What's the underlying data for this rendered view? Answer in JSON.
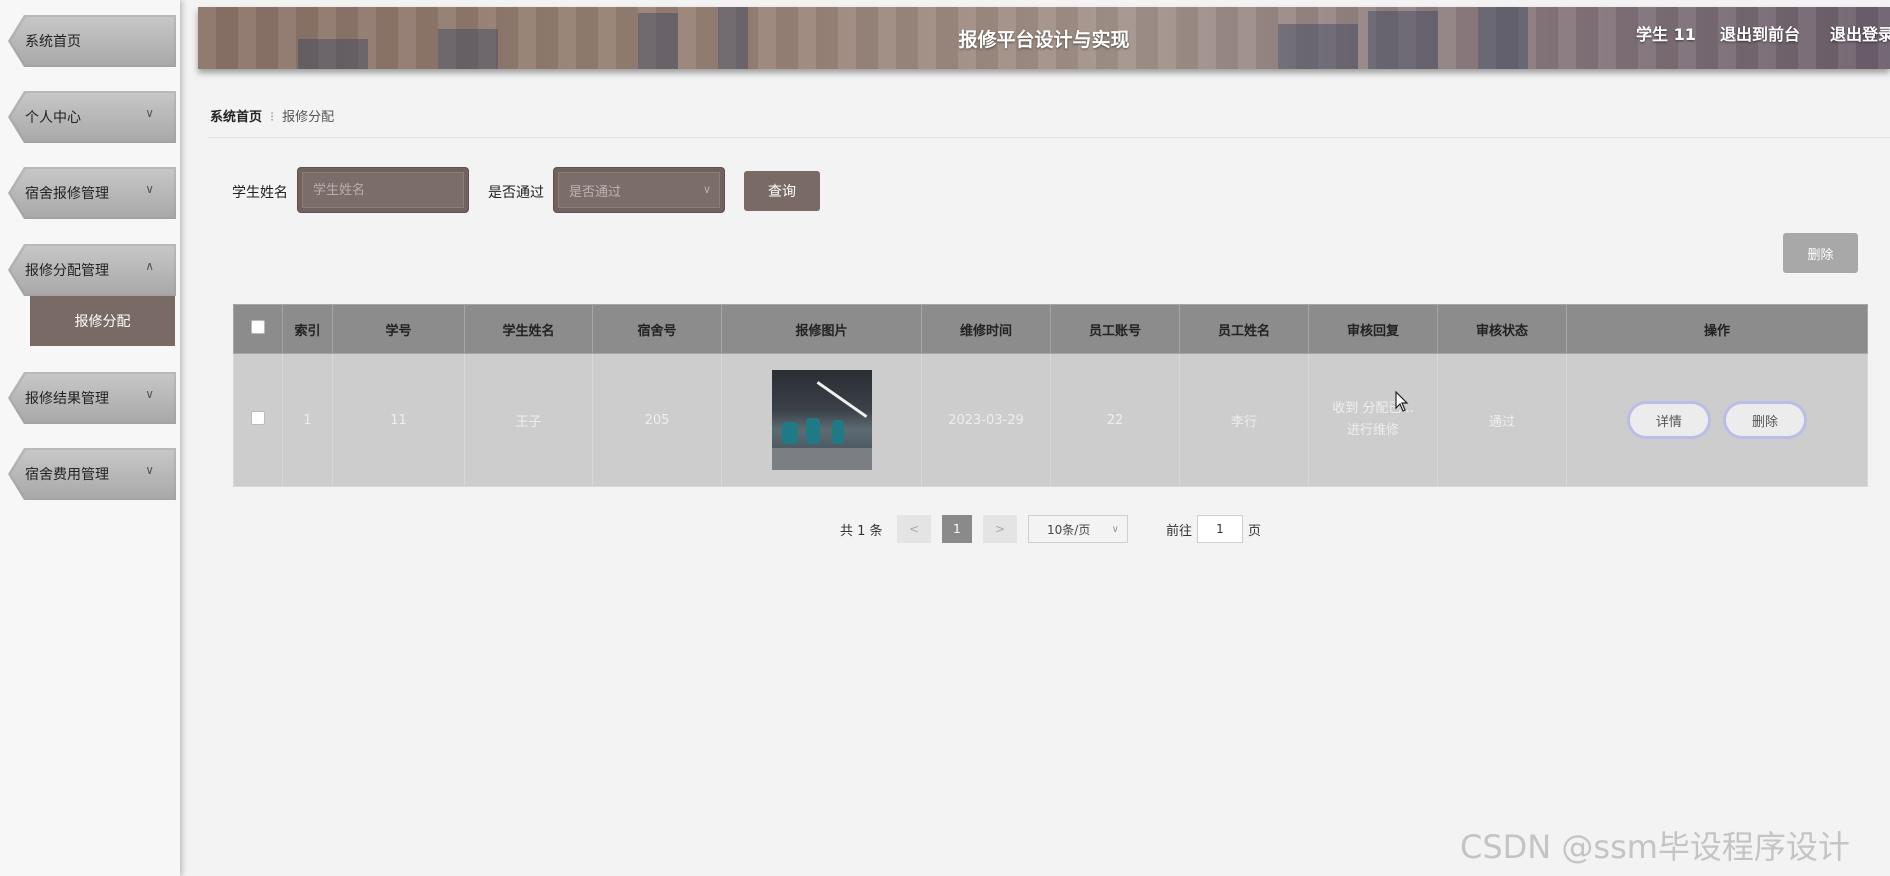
{
  "sidebar": {
    "items": [
      {
        "label": "系统首页",
        "chevron": ""
      },
      {
        "label": "个人中心",
        "chevron": "∨"
      },
      {
        "label": "宿舍报修管理",
        "chevron": "∨"
      },
      {
        "label": "报修分配管理",
        "chevron": "∧"
      },
      {
        "label": "报修结果管理",
        "chevron": "∨"
      },
      {
        "label": "宿舍费用管理",
        "chevron": "∨"
      }
    ],
    "active_sub": "报修分配"
  },
  "header": {
    "title": "报修平台设计与实现",
    "user": "学生 11",
    "front_link": "退出到前台",
    "logout": "退出登录"
  },
  "breadcrumb": {
    "home": "系统首页",
    "separator": "⁝",
    "current": "报修分配"
  },
  "search": {
    "name_label": "学生姓名",
    "name_placeholder": "学生姓名",
    "pass_label": "是否通过",
    "pass_placeholder": "是否通过",
    "query_button": "查询"
  },
  "toolbar": {
    "delete_button": "删除"
  },
  "table": {
    "headers": [
      "索引",
      "学号",
      "学生姓名",
      "宿舍号",
      "报修图片",
      "维修时间",
      "员工账号",
      "员工姓名",
      "审核回复",
      "审核状态",
      "操作"
    ],
    "rows": [
      {
        "index": "1",
        "student_no": "11",
        "student_name": "王子",
        "dorm": "205",
        "repair_time": "2023-03-29",
        "staff_account": "22",
        "staff_name": "李行",
        "reply_line1": "收到 分配已...",
        "reply_line2": "进行维修",
        "status": "通过",
        "detail_button": "详情",
        "delete_button": "删除"
      }
    ]
  },
  "pagination": {
    "total": "共 1 条",
    "prev": "<",
    "current_page": "1",
    "next": ">",
    "page_size": "10条/页",
    "goto_label": "前往",
    "goto_value": "1",
    "page_suffix": "页"
  },
  "watermark": "CSDN @ssm毕设程序设计",
  "colors": {
    "accent": "#7a6a66",
    "table_header": "#8c8c8c",
    "table_row": "#cdcdcd"
  }
}
